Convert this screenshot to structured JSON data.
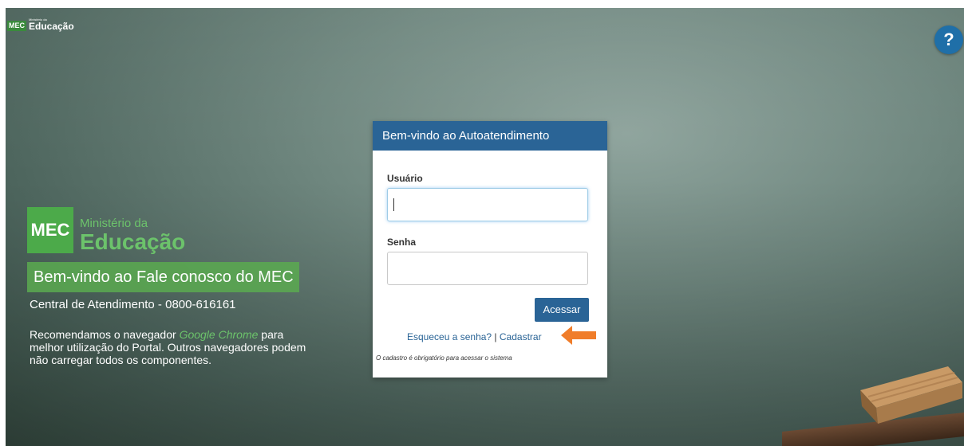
{
  "header": {
    "mini_logo_mec": "MEC",
    "mini_logo_ministerio": "Ministério da",
    "mini_logo_educacao": "Educação",
    "help_symbol": "?"
  },
  "branding": {
    "mec": "MEC",
    "ministerio": "Ministério da",
    "educacao": "Educação",
    "welcome": "Bem-vindo ao Fale conosco do MEC",
    "central": "Central de Atendimento - 0800-616161",
    "recommend_prefix": "Recomendamos o navegador ",
    "recommend_browser": "Google Chrome",
    "recommend_suffix": " para melhor utilização do Portal. Outros navegadores podem não carregar todos os componentes."
  },
  "login": {
    "title": "Bem-vindo ao Autoatendimento",
    "user_label": "Usuário",
    "user_value": "",
    "password_label": "Senha",
    "password_value": "",
    "submit_label": "Acessar",
    "forgot_label": "Esqueceu a senha?",
    "separator": " | ",
    "register_label": "Cadastrar",
    "note": "O cadastro é obrigatório para acessar o sistema"
  },
  "colors": {
    "brand_green": "#4caa4a",
    "primary_blue": "#2a6496",
    "arrow_orange": "#f07d2a"
  },
  "icons": {
    "help": "help-icon",
    "arrow": "orange-arrow-icon"
  }
}
